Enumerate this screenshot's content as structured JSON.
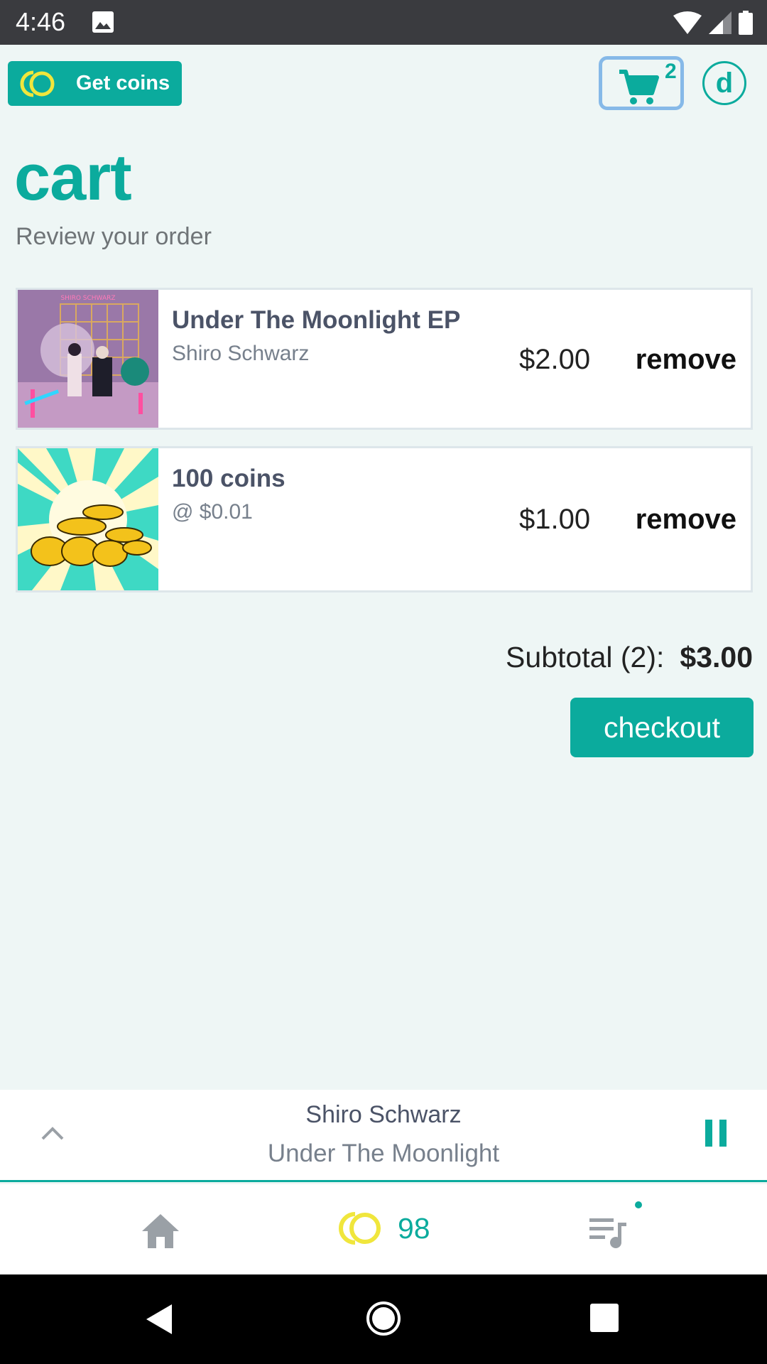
{
  "status_bar": {
    "time": "4:46"
  },
  "header": {
    "get_coins_label": "Get coins",
    "cart_count": "2",
    "avatar_letter": "d"
  },
  "page": {
    "title": "cart",
    "subtitle": "Review your order"
  },
  "cart": {
    "items": [
      {
        "title": "Under The Moonlight EP",
        "subtitle": "Shiro Schwarz",
        "price": "$2.00",
        "remove_label": "remove",
        "album_cover_text": "SHIRO SCHWARZ"
      },
      {
        "title": "100 coins",
        "subtitle": "@ $0.01",
        "price": "$1.00",
        "remove_label": "remove"
      }
    ],
    "subtotal_label": "Subtotal (2):",
    "subtotal_amount": "$3.00",
    "checkout_label": "checkout"
  },
  "player": {
    "artist": "Shiro Schwarz",
    "track": "Under The Moonlight"
  },
  "bottom_nav": {
    "coin_balance": "98"
  },
  "colors": {
    "accent": "#0bab9d",
    "coin_yellow": "#f0e63c",
    "background": "#eef6f5",
    "cart_highlight": "#86b9e8"
  }
}
